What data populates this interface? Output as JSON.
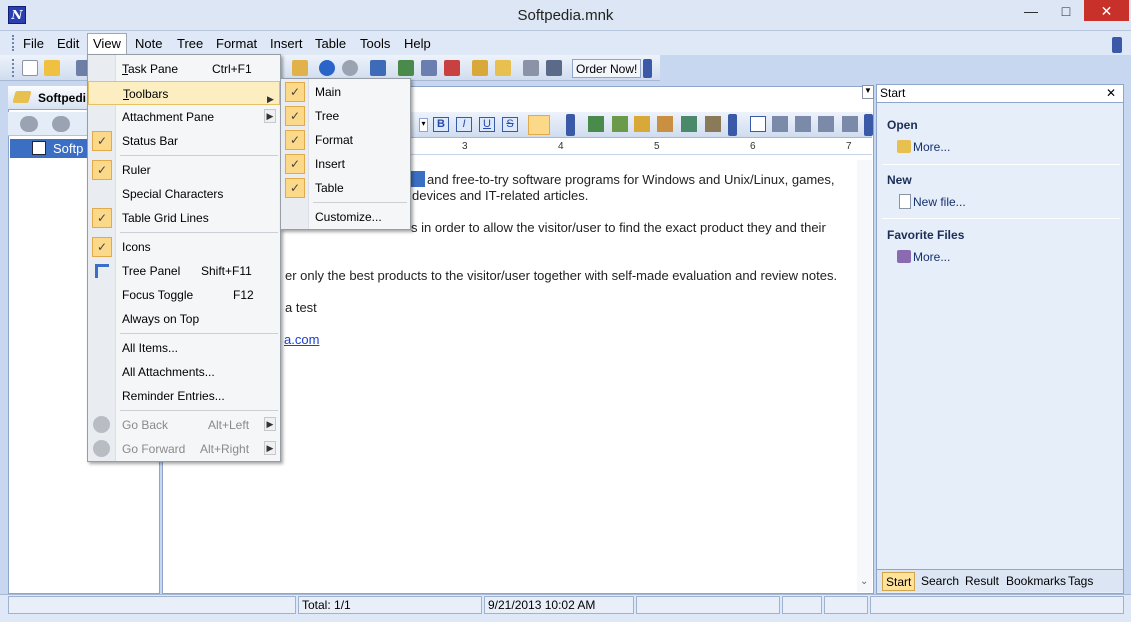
{
  "window": {
    "title": "Softpedia.mnk",
    "app_icon_letter": "N",
    "minimize": "—",
    "maximize": "□",
    "close": "✕"
  },
  "menubar": {
    "items": [
      "File",
      "Edit",
      "View",
      "Note",
      "Tree",
      "Format",
      "Insert",
      "Table",
      "Tools",
      "Help"
    ]
  },
  "toolbar": {
    "order_now": "Order Now!"
  },
  "left_panel": {
    "tab_label": "Softpedi",
    "tree_node": "Softp"
  },
  "view_menu": {
    "items": [
      {
        "label": "Task Pane",
        "shortcut": "Ctrl+F1",
        "checked": false
      },
      {
        "label": "Toolbars",
        "shortcut": "",
        "checked": false,
        "submenu": true,
        "highlighted": true
      },
      {
        "label": "Attachment Pane",
        "shortcut": "",
        "checked": false,
        "submenu": true
      },
      {
        "label": "Status Bar",
        "shortcut": "",
        "checked": true
      },
      {
        "label": "Ruler",
        "shortcut": "",
        "checked": true
      },
      {
        "label": "Special Characters",
        "shortcut": "",
        "checked": false
      },
      {
        "label": "Table Grid Lines",
        "shortcut": "",
        "checked": true
      },
      {
        "label": "Icons",
        "shortcut": "",
        "checked": true
      },
      {
        "label": "Tree Panel",
        "shortcut": "Shift+F11",
        "checked": false
      },
      {
        "label": "Focus Toggle",
        "shortcut": "F12",
        "checked": false
      },
      {
        "label": "Always on Top",
        "shortcut": "",
        "checked": false
      },
      {
        "label": "All Items...",
        "shortcut": "",
        "checked": false
      },
      {
        "label": "All Attachments...",
        "shortcut": "",
        "checked": false
      },
      {
        "label": "Reminder Entries...",
        "shortcut": "",
        "checked": false
      },
      {
        "label": "Go Back",
        "shortcut": "Alt+Left",
        "disabled": true
      },
      {
        "label": "Go Forward",
        "shortcut": "Alt+Right",
        "disabled": true
      }
    ]
  },
  "toolbars_submenu": {
    "items": [
      {
        "label": "Main",
        "checked": true
      },
      {
        "label": "Tree",
        "checked": true
      },
      {
        "label": "Format",
        "checked": true
      },
      {
        "label": "Insert",
        "checked": true
      },
      {
        "label": "Table",
        "checked": true
      },
      {
        "label": "Customize...",
        "checked": false
      }
    ]
  },
  "editor": {
    "lines": [
      "and free-to-try software programs for Windows and Unix/Linux, games,",
      "devices and IT-related articles.",
      "s in order to allow the visitor/user to find the exact product they and their",
      "er only the best products to the visitor/user together with self-made evaluation and review notes.",
      "a test",
      "a.com"
    ],
    "ruler_marks": [
      "3",
      "4",
      "5",
      "6",
      "7"
    ]
  },
  "task_pane": {
    "title": "Start",
    "sections": [
      {
        "heading": "Open",
        "link": "More..."
      },
      {
        "heading": "New",
        "link": "New file..."
      },
      {
        "heading": "Favorite Files",
        "link": "More..."
      }
    ],
    "tabs": [
      "Start",
      "Search",
      "Result",
      "Bookmarks",
      "Tags"
    ]
  },
  "statusbar": {
    "total": "Total: 1/1",
    "datetime": "9/21/2013 10:02 AM"
  },
  "colors": {
    "accent_highlight": "#fdeec2",
    "check_bg": "#fbd989",
    "panel_bg": "#e6eef9"
  }
}
